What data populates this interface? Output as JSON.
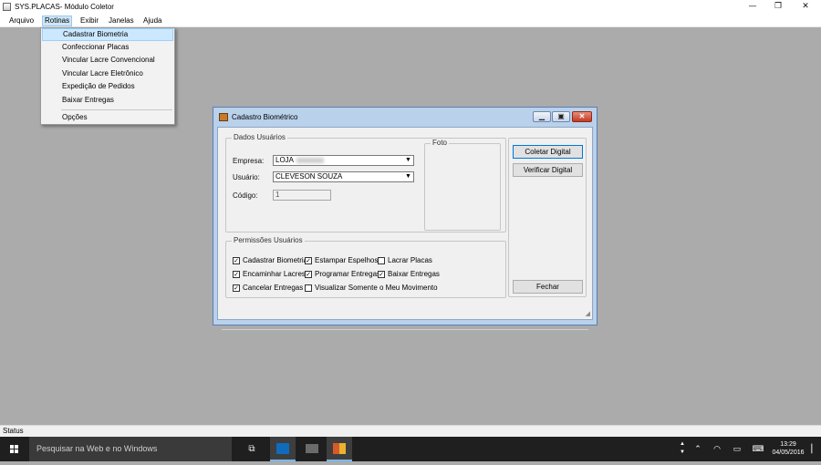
{
  "app": {
    "title": "SYS.PLACAS- Módulo Coletor",
    "controls": {
      "minimize": "—",
      "maximize": "❐",
      "close": "✕"
    }
  },
  "menubar": {
    "items": [
      "Arquivo",
      "Rotinas",
      "Exibir",
      "Janelas",
      "Ajuda"
    ],
    "active": "Rotinas"
  },
  "dropdown": {
    "items": [
      "Cadastrar Biometria",
      "Confeccionar Placas",
      "Vincular Lacre Convencional",
      "Vincular Lacre Eletrônico",
      "Expedição de Pedidos",
      "Baixar Entregas",
      "Opções"
    ],
    "highlighted": "Cadastrar Biometria"
  },
  "dialog": {
    "title": "Cadastro Biométrico",
    "group_dados": "Dados Usuários",
    "label_empresa": "Empresa:",
    "value_empresa": "LOJA",
    "label_usuario": "Usuário:",
    "value_usuario": "CLEVESON SOUZA",
    "label_codigo": "Código:",
    "value_codigo": "1",
    "group_foto": "Foto",
    "btn_coletar": "Coletar Digital",
    "btn_verificar": "Verificar Digital",
    "btn_fechar": "Fechar",
    "group_permissoes": "Permissões Usuários",
    "permissions": [
      {
        "label": "Cadastrar Biometria",
        "checked": true
      },
      {
        "label": "Estampar Espelhos",
        "checked": true
      },
      {
        "label": "Lacrar Placas",
        "checked": false
      },
      {
        "label": "Encaminhar Lacres",
        "checked": true
      },
      {
        "label": "Programar Entregas",
        "checked": true
      },
      {
        "label": "Baixar Entregas",
        "checked": true
      },
      {
        "label": "Cancelar Entregas",
        "checked": true
      },
      {
        "label": "Visualizar Somente o Meu Movimento",
        "checked": false
      }
    ]
  },
  "status": {
    "text": "Status"
  },
  "taskbar": {
    "search_placeholder": "Pesquisar na Web e no Windows",
    "time": "13:29",
    "date": "04/05/2016"
  }
}
